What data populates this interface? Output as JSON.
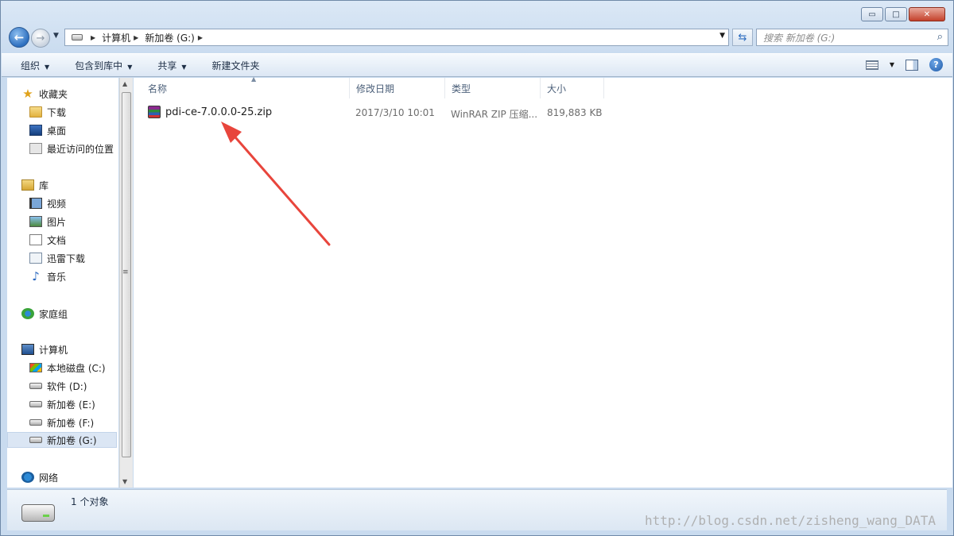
{
  "window": {
    "caption_buttons": {
      "minimize": "▭",
      "maximize": "□",
      "close": "✕"
    }
  },
  "address": {
    "segments": [
      "计算机",
      "新加卷 (G:)"
    ]
  },
  "search": {
    "placeholder": "搜索 新加卷 (G:)"
  },
  "toolbar": {
    "organize": "组织",
    "include_in_library": "包含到库中",
    "share": "共享",
    "new_folder": "新建文件夹"
  },
  "sidebar": {
    "favorites": "收藏夹",
    "downloads": "下载",
    "desktop": "桌面",
    "recent": "最近访问的位置",
    "libraries": "库",
    "videos": "视频",
    "pictures": "图片",
    "documents": "文档",
    "thunder": "迅雷下载",
    "music": "音乐",
    "homegroup": "家庭组",
    "computer": "计算机",
    "drive_c": "本地磁盘 (C:)",
    "drive_d": "软件 (D:)",
    "drive_e": "新加卷 (E:)",
    "drive_f": "新加卷 (F:)",
    "drive_g": "新加卷 (G:)",
    "network": "网络"
  },
  "columns": {
    "name": "名称",
    "date": "修改日期",
    "type": "类型",
    "size": "大小"
  },
  "files": [
    {
      "name": "pdi-ce-7.0.0.0-25.zip",
      "date": "2017/3/10 10:01",
      "type": "WinRAR ZIP 压缩...",
      "size": "819,883 KB"
    }
  ],
  "status": {
    "count": "1 个对象"
  },
  "watermark": "http://blog.csdn.net/zisheng_wang_DATA",
  "colors": {
    "arrow": "#e8453c",
    "accent": "#2d6fbf"
  }
}
